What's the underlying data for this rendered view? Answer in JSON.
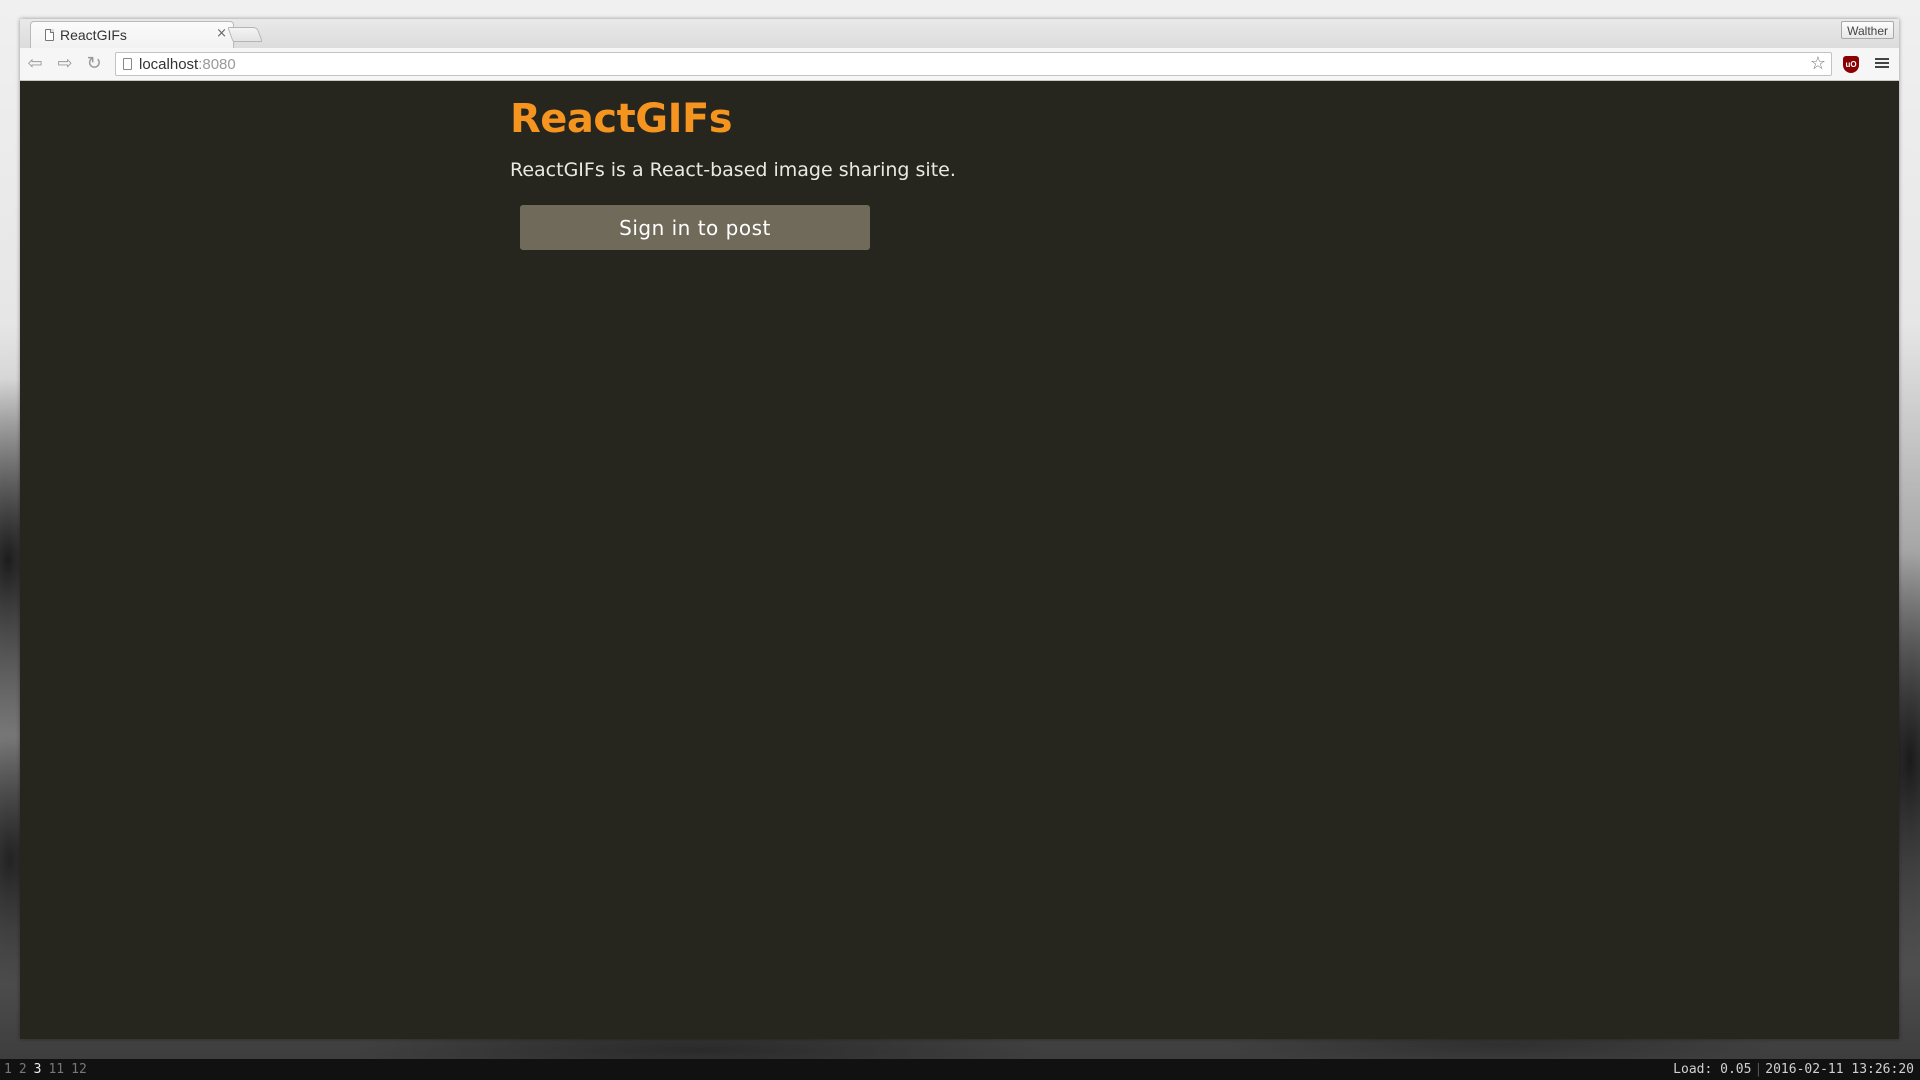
{
  "browser": {
    "tab": {
      "title": "ReactGIFs",
      "close": "×"
    },
    "profile": "Walther",
    "toolbar": {
      "back": "⇦",
      "forward": "⇨",
      "reload": "↻"
    },
    "omnibox": {
      "host": "localhost",
      "port": ":8080"
    },
    "star": "☆",
    "extension": "uO"
  },
  "page": {
    "title": "ReactGIFs",
    "description": "ReactGIFs is a React-based image sharing site.",
    "signin_label": "Sign in to post"
  },
  "statusbar": {
    "workspaces": [
      "1",
      "2",
      "3",
      "11",
      "12"
    ],
    "active_workspace": "3",
    "load": "Load: 0.05",
    "separator": "|",
    "datetime": "2016-02-11 13:26:20"
  },
  "colors": {
    "page_background": "#26261f",
    "title_accent": "#f5941f",
    "button_background": "#6f6a59"
  }
}
